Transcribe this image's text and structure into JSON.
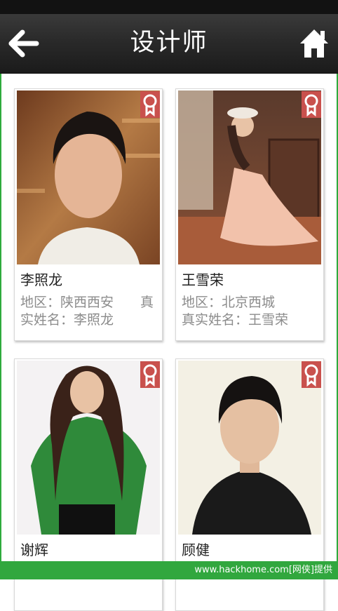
{
  "header": {
    "title": "设计师",
    "back_icon": "arrow-left-icon",
    "home_icon": "home-icon"
  },
  "designers": [
    {
      "name": "李照龙",
      "region_line": "地区：陕西西安　　真",
      "realname_line": "实姓名：李照龙"
    },
    {
      "name": "王雪荣",
      "region_line": "地区：北京西城",
      "realname_line": "真实姓名：王雪荣"
    },
    {
      "name": "谢辉"
    },
    {
      "name": "顾健"
    }
  ],
  "badge_icon": "ribbon-award-icon",
  "watermark": "www.hackhome.com[网侠]提供",
  "colors": {
    "header_bg": "#2a2a2a",
    "badge": "#c9514d",
    "footer": "#31a73e"
  }
}
